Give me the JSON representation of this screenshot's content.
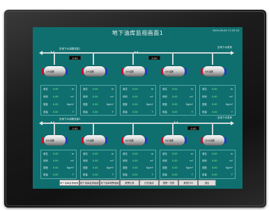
{
  "screen": {
    "title": "地下油库监视画面1",
    "clock": "2009-06-04 17:05:18"
  },
  "sections": [
    {
      "pipe_label": "至地下水泵房",
      "flow_label": "至地下水油箱流量1",
      "flow_value": "0.00",
      "tanks": [
        {
          "label": "1#油罐",
          "table": {
            "rows": [
              {
                "label": "液位",
                "value": "0.00",
                "unit": "m"
              },
              {
                "label": "体积",
                "value": "0.00",
                "unit": "m³"
              },
              {
                "label": "密度",
                "value": "0.00",
                "unit": "Kg/m³"
              },
              {
                "label": "质量",
                "value": "0.00",
                "unit": "T"
              }
            ]
          }
        },
        {
          "label": "2#油罐",
          "table": {
            "rows": [
              {
                "label": "液位",
                "value": "0.00",
                "unit": "m"
              },
              {
                "label": "体积",
                "value": "0.00",
                "unit": "m³"
              },
              {
                "label": "密度",
                "value": "0.00",
                "unit": "Kg/m³"
              },
              {
                "label": "质量",
                "value": "0.00",
                "unit": "T"
              }
            ]
          }
        },
        {
          "label": "3#油罐",
          "table": {
            "rows": [
              {
                "label": "液位",
                "value": "0.00",
                "unit": "m"
              },
              {
                "label": "体积",
                "value": "0.00",
                "unit": "m³"
              },
              {
                "label": "密度",
                "value": "0.00",
                "unit": "Kg/m³"
              },
              {
                "label": "质量",
                "value": "0.00",
                "unit": "T"
              }
            ]
          }
        },
        {
          "label": "4#油罐",
          "table": {
            "rows": [
              {
                "label": "液位",
                "value": "0.00",
                "unit": "m"
              },
              {
                "label": "体积",
                "value": "0.00",
                "unit": "m³"
              },
              {
                "label": "密度",
                "value": "0.00",
                "unit": "Kg/m³"
              },
              {
                "label": "质量",
                "value": "0.00",
                "unit": "T"
              }
            ]
          }
        },
        {
          "label": "5#油罐",
          "table": {
            "rows": [
              {
                "label": "液位",
                "value": "0.00",
                "unit": "m"
              },
              {
                "label": "体积",
                "value": "0.00",
                "unit": "m³"
              },
              {
                "label": "密度",
                "value": "0.00",
                "unit": "Kg/m³"
              },
              {
                "label": "质量",
                "value": "0.00",
                "unit": "T"
              }
            ]
          }
        }
      ],
      "flow_boxes": [
        "0.00",
        "0.00"
      ]
    },
    {
      "pipe_label": "至地下水泵房",
      "flow_label": "至地下水油箱流量2",
      "flow_value": "0.00",
      "tanks": [
        {
          "label": "6#油罐",
          "table": {
            "rows": [
              {
                "label": "液位",
                "value": "0.00",
                "unit": "m"
              },
              {
                "label": "体积",
                "value": "0.00",
                "unit": "m³"
              },
              {
                "label": "密度",
                "value": "0.00",
                "unit": "Kg/m³"
              },
              {
                "label": "质量",
                "value": "0.00",
                "unit": "T"
              }
            ]
          }
        },
        {
          "label": "7#油罐",
          "table": {
            "rows": [
              {
                "label": "液位",
                "value": "0.00",
                "unit": "m"
              },
              {
                "label": "体积",
                "value": "0.00",
                "unit": "m³"
              },
              {
                "label": "密度",
                "value": "0.00",
                "unit": "Kg/m³"
              },
              {
                "label": "质量",
                "value": "0.00",
                "unit": "T"
              }
            ]
          }
        },
        {
          "label": "8#油罐",
          "table": {
            "rows": [
              {
                "label": "液位",
                "value": "0.00",
                "unit": "m"
              },
              {
                "label": "体积",
                "value": "0.00",
                "unit": "m³"
              },
              {
                "label": "密度",
                "value": "0.00",
                "unit": "Kg/m³"
              },
              {
                "label": "质量",
                "value": "0.00",
                "unit": "T"
              }
            ]
          }
        },
        {
          "label": "9#油罐",
          "table": {
            "rows": [
              {
                "label": "液位",
                "value": "0.00",
                "unit": "m"
              },
              {
                "label": "体积",
                "value": "0.00",
                "unit": "m³"
              },
              {
                "label": "密度",
                "value": "0.00",
                "unit": "Kg/m³"
              },
              {
                "label": "质量",
                "value": "0.00",
                "unit": "T"
              }
            ]
          }
        },
        {
          "label": "10#油罐",
          "table": {
            "rows": [
              {
                "label": "液位",
                "value": "0.00",
                "unit": "m"
              },
              {
                "label": "体积",
                "value": "0.00",
                "unit": "m³"
              },
              {
                "label": "密度",
                "value": "0.00",
                "unit": "Kg/m³"
              },
              {
                "label": "质量",
                "value": "0.00",
                "unit": "T"
              }
            ]
          }
        }
      ],
      "flow_boxes": [
        "0.00",
        "0.00"
      ]
    }
  ],
  "tabs": [
    {
      "label": "地下油库监视画面1"
    },
    {
      "label": "地下油库监视画面2"
    },
    {
      "label": "地下油库报警画面"
    },
    {
      "label": "报警记录"
    },
    {
      "label": "历史曲线"
    },
    {
      "label": "报警一览表"
    },
    {
      "label": "报表打印"
    },
    {
      "label": "退出"
    }
  ],
  "colors": {
    "screen_bg": "#0f6f6f",
    "value_green": "#8fff8f",
    "bezel": "#1b1b1b",
    "cap_red": "#c8102e",
    "cap_blue": "#2337c6"
  }
}
